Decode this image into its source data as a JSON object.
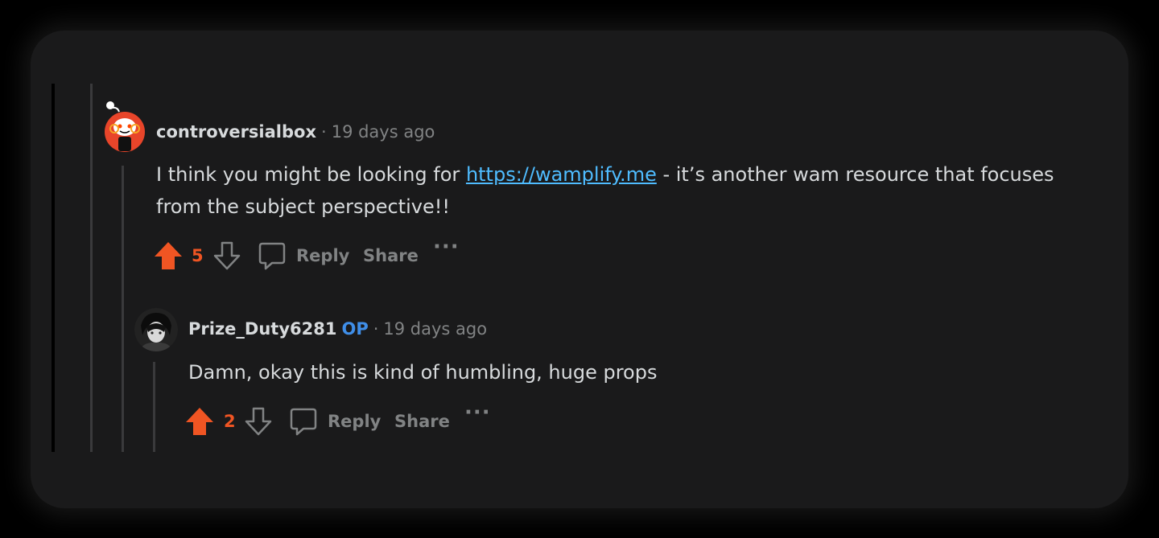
{
  "comments": [
    {
      "username": "controversialbox",
      "separator": "·",
      "time": "19 days ago",
      "body_before": "I think you might be looking for ",
      "body_link": "https://wamplify.me",
      "body_after": " - it’s another wam resource that focuses from the subject perspective!!",
      "score": "5",
      "reply_label": "Reply",
      "share_label": "Share",
      "more_label": "···"
    },
    {
      "username": "Prize_Duty6281",
      "op_badge": "OP",
      "separator": "·",
      "time": "19 days ago",
      "body": "Damn, okay this is kind of humbling, huge props",
      "score": "2",
      "reply_label": "Reply",
      "share_label": "Share",
      "more_label": "···"
    }
  ],
  "colors": {
    "background": "#1a1a1b",
    "upvote": "#f05523",
    "link": "#4fbcff",
    "op_badge": "#3f8ee8",
    "muted": "#818384",
    "text": "#d7dadc"
  },
  "icons": {
    "avatar1": "snoo-avatar-icon",
    "avatar2": "user-avatar-icon",
    "upvote": "upvote-arrow-icon",
    "downvote": "downvote-arrow-icon",
    "reply": "comment-bubble-icon",
    "more": "more-options-icon"
  }
}
